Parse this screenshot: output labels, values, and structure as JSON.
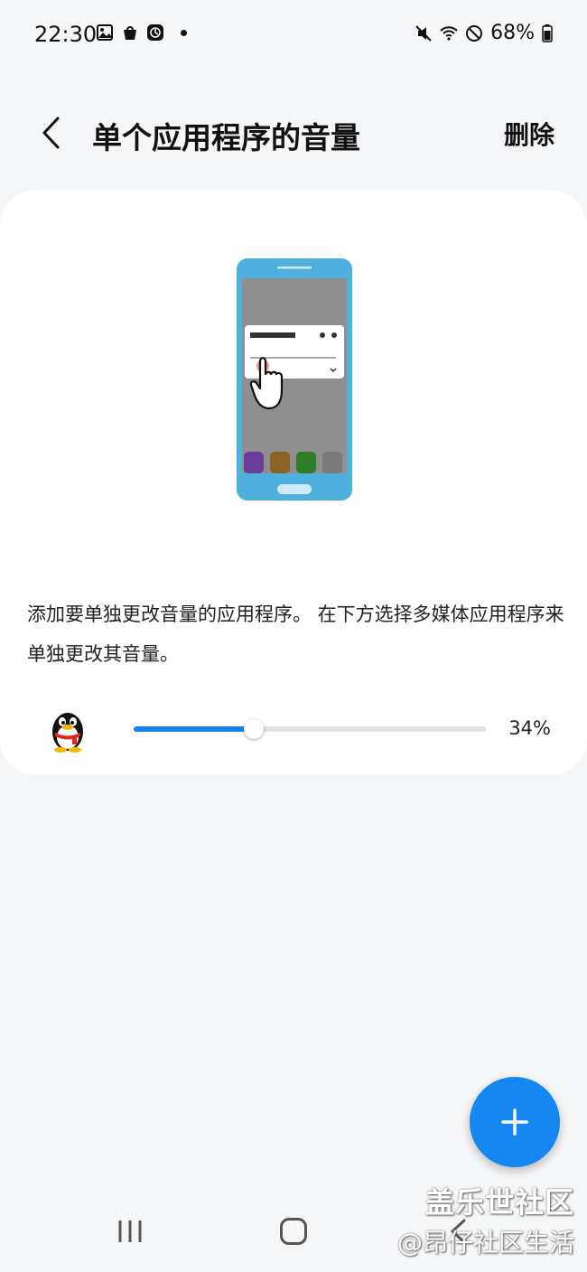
{
  "status_bar": {
    "time": "22:30",
    "left_icons": [
      "gallery-icon",
      "shopping-bag-icon",
      "clock-app-icon"
    ],
    "right_icons": [
      "mute-icon",
      "wifi-icon",
      "do-not-disturb-icon"
    ],
    "battery": "68%"
  },
  "header": {
    "title": "单个应用程序的音量",
    "delete_label": "删除"
  },
  "card": {
    "description": "添加要单独更改音量的应用程序。 在下方选择多媒体应用程序来单独更改其音量。",
    "apps": [
      {
        "icon": "qq-penguin-icon",
        "volume_fraction": 0.34,
        "volume_label": "34%"
      }
    ]
  },
  "fab": {
    "label": "+"
  },
  "watermark": {
    "line1": "盖乐世社区",
    "line2": "@昂仔社区生活"
  },
  "colors": {
    "accent": "#1488f0",
    "slider_fill": "#1a80e8",
    "background": "#f5f6f7",
    "card": "#ffffff"
  }
}
